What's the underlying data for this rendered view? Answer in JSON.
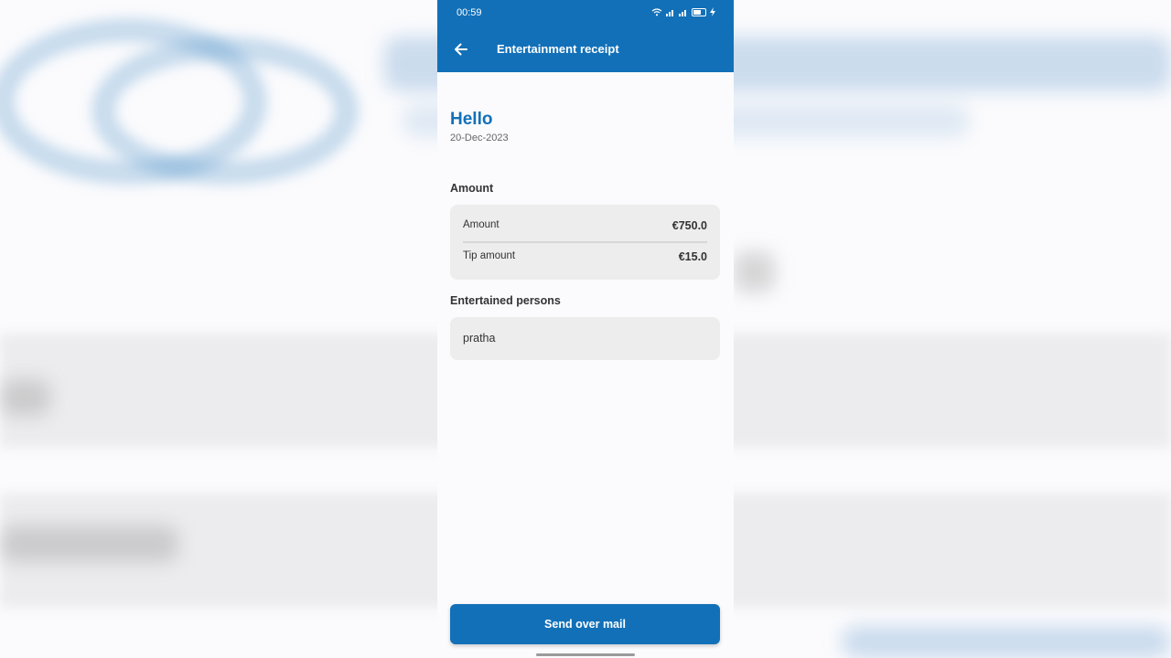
{
  "status_bar": {
    "time": "00:59"
  },
  "appbar": {
    "title": "Entertainment receipt",
    "back_icon": "arrow-left-icon"
  },
  "header": {
    "greeting": "Hello",
    "date": "20-Dec-2023"
  },
  "amount_section": {
    "label": "Amount",
    "rows": [
      {
        "label": "Amount",
        "value": "€750.0"
      },
      {
        "label": "Tip amount",
        "value": "€15.0"
      }
    ]
  },
  "persons_section": {
    "label": "Entertained persons",
    "persons": [
      "pratha"
    ]
  },
  "footer": {
    "send_label": "Send over mail"
  },
  "colors": {
    "primary": "#1270b8",
    "card": "#ededed",
    "page": "#fbfbfe"
  }
}
